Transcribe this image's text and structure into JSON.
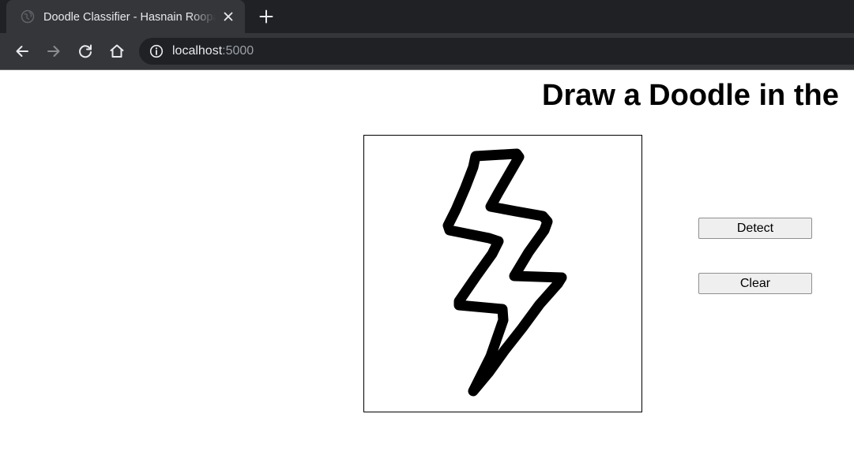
{
  "browser": {
    "tab": {
      "title": "Doodle Classifier - Hasnain Roopawalla",
      "favicon": "globe-icon",
      "close_icon": "close-icon"
    },
    "new_tab_icon": "plus-icon",
    "nav": {
      "back_icon": "arrow-left-icon",
      "forward_icon": "arrow-right-icon",
      "reload_icon": "reload-icon",
      "home_icon": "home-icon"
    },
    "omnibox": {
      "info_icon": "info-icon",
      "host": "localhost",
      "port": ":5000"
    },
    "colors": {
      "tabstrip": "#202124",
      "active_tab": "#35363a",
      "text": "#e8eaed",
      "muted_text": "#9aa0a6"
    }
  },
  "page": {
    "heading": "Draw a Doodle in the",
    "canvas": {
      "drawing": "lightning-bolt-doodle",
      "stroke_color": "#000000"
    },
    "buttons": {
      "detect": "Detect",
      "clear": "Clear"
    }
  }
}
